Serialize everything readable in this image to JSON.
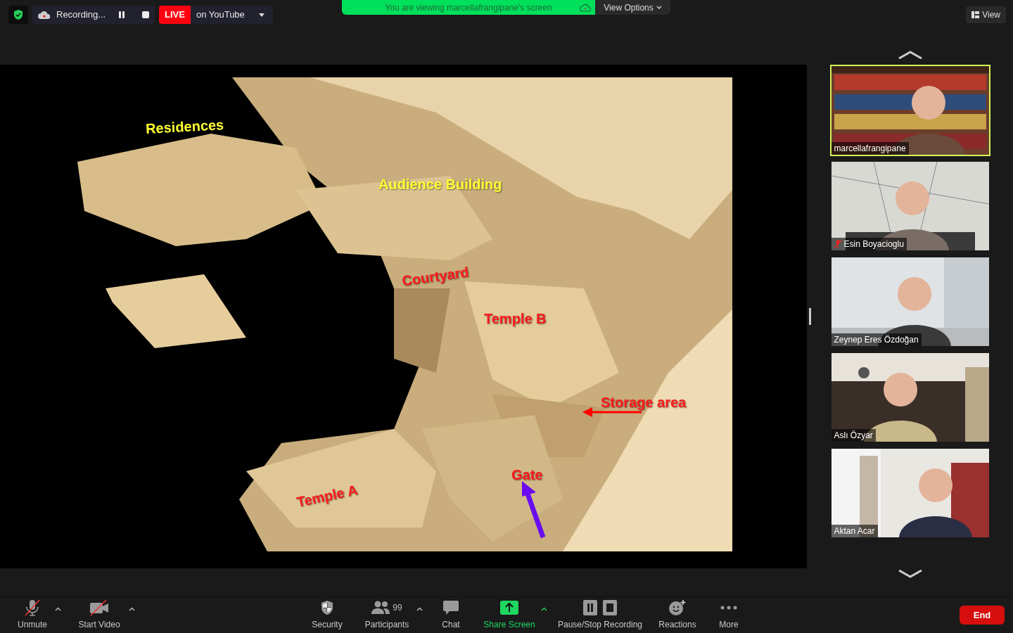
{
  "top_bar": {
    "recording": "Recording...",
    "live_badge": "LIVE",
    "live_target": "on YouTube",
    "view_button": "View"
  },
  "banner": {
    "text": "You are viewing marcellafrangipane's screen",
    "view_options": "View Options"
  },
  "slide": {
    "labels": [
      {
        "text": "Residences",
        "color": "#ffff33"
      },
      {
        "text": "Audience Building",
        "color": "#ffff33"
      },
      {
        "text": "Courtyard",
        "color": "#ff1a1a"
      },
      {
        "text": "Temple B",
        "color": "#ff1a1a"
      },
      {
        "text": "Storage area",
        "color": "#ff1a1a"
      },
      {
        "text": "Gate",
        "color": "#ff1a1a"
      },
      {
        "text": "Temple A",
        "color": "#ff1a1a"
      }
    ]
  },
  "participants": [
    {
      "name": "marcellafrangipane",
      "speaking": true,
      "muted": false
    },
    {
      "name": "Esin Boyacioglu",
      "speaking": false,
      "muted": true
    },
    {
      "name": "Zeynep Eres Özdoğan",
      "speaking": false,
      "muted": false
    },
    {
      "name": "Aslı Özyar",
      "speaking": false,
      "muted": false
    },
    {
      "name": "Aktan Acar",
      "speaking": false,
      "muted": false
    }
  ],
  "toolbar": {
    "items": [
      {
        "kind": "mic",
        "label": "Unmute",
        "caret": true
      },
      {
        "kind": "video",
        "label": "Start Video",
        "caret": true
      },
      {
        "kind": "security",
        "label": "Security",
        "caret": false
      },
      {
        "kind": "participants",
        "label": "Participants",
        "count": "99",
        "caret": true
      },
      {
        "kind": "chat",
        "label": "Chat",
        "caret": false
      },
      {
        "kind": "share",
        "label": "Share Screen",
        "caret": true
      },
      {
        "kind": "recording",
        "label": "Pause/Stop Recording",
        "caret": false
      },
      {
        "kind": "reactions",
        "label": "Reactions",
        "caret": false
      },
      {
        "kind": "more",
        "label": "More",
        "caret": false
      }
    ],
    "end": "End"
  }
}
